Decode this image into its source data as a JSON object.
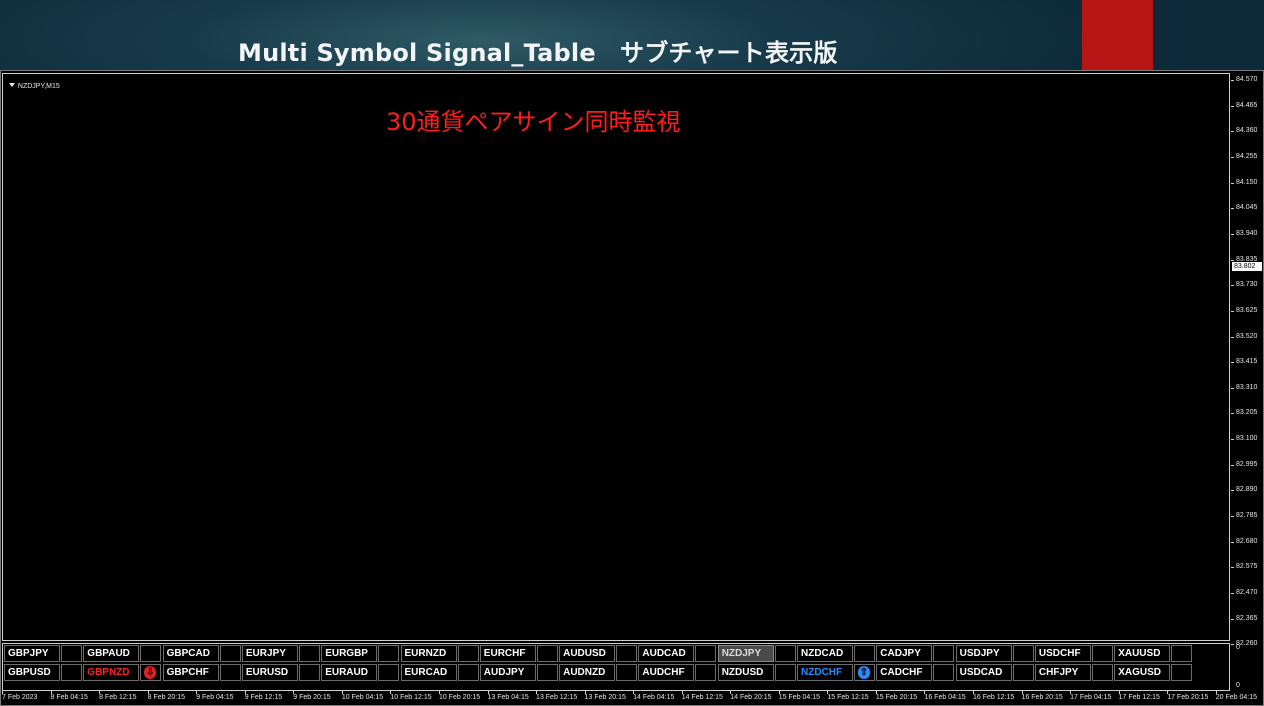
{
  "banner": {
    "title": "Multi Symbol Signal_Table　サブチャート表示版",
    "accent_color": "#b51614"
  },
  "chart": {
    "symbol_timeframe": "NZDJPY,M15",
    "overlay_text": "30通貨ペアサイン同時監視",
    "overlay_color": "#ff1c1c",
    "current_price": "83.802",
    "price_ticks": [
      "84.570",
      "84.465",
      "84.360",
      "84.255",
      "84.150",
      "84.045",
      "83.940",
      "83.835",
      "83.730",
      "83.625",
      "83.520",
      "83.415",
      "83.310",
      "83.205",
      "83.100",
      "82.995",
      "82.890",
      "82.785",
      "82.680",
      "82.575",
      "82.470",
      "82.365",
      "82.260"
    ],
    "time_ticks": [
      "7 Feb 2023",
      "8 Feb 04:15",
      "8 Feb 12:15",
      "8 Feb 20:15",
      "9 Feb 04:15",
      "9 Feb 12:15",
      "9 Feb 20:15",
      "10 Feb 04:15",
      "10 Feb 12:15",
      "10 Feb 20:15",
      "13 Feb 04:15",
      "13 Feb 12:15",
      "13 Feb 20:15",
      "14 Feb 04:15",
      "14 Feb 12:15",
      "14 Feb 20:15",
      "15 Feb 04:15",
      "15 Feb 12:15",
      "15 Feb 20:15",
      "16 Feb 04:15",
      "16 Feb 12:15",
      "16 Feb 20:15",
      "17 Feb 04:15",
      "17 Feb 12:15",
      "17 Feb 20:15",
      "20 Feb 04:15"
    ]
  },
  "subwindow": {
    "axis_top": "0",
    "axis_bottom": "0",
    "rows": [
      [
        {
          "symbol": "GBPJPY",
          "state": "normal",
          "signal": ""
        },
        {
          "symbol": "GBPAUD",
          "state": "normal",
          "signal": ""
        },
        {
          "symbol": "GBPCAD",
          "state": "normal",
          "signal": ""
        },
        {
          "symbol": "EURJPY",
          "state": "normal",
          "signal": ""
        },
        {
          "symbol": "EURGBP",
          "state": "normal",
          "signal": ""
        },
        {
          "symbol": "EURNZD",
          "state": "normal",
          "signal": ""
        },
        {
          "symbol": "EURCHF",
          "state": "normal",
          "signal": ""
        },
        {
          "symbol": "AUDUSD",
          "state": "normal",
          "signal": ""
        },
        {
          "symbol": "AUDCAD",
          "state": "normal",
          "signal": ""
        },
        {
          "symbol": "NZDJPY",
          "state": "selected",
          "signal": ""
        },
        {
          "symbol": "NZDCAD",
          "state": "normal",
          "signal": ""
        },
        {
          "symbol": "CADJPY",
          "state": "normal",
          "signal": ""
        },
        {
          "symbol": "USDJPY",
          "state": "normal",
          "signal": ""
        },
        {
          "symbol": "USDCHF",
          "state": "normal",
          "signal": ""
        },
        {
          "symbol": "XAUUSD",
          "state": "normal",
          "signal": ""
        }
      ],
      [
        {
          "symbol": "GBPUSD",
          "state": "normal",
          "signal": ""
        },
        {
          "symbol": "GBPNZD",
          "state": "sell",
          "signal": "down"
        },
        {
          "symbol": "GBPCHF",
          "state": "normal",
          "signal": ""
        },
        {
          "symbol": "EURUSD",
          "state": "normal",
          "signal": ""
        },
        {
          "symbol": "EURAUD",
          "state": "normal",
          "signal": ""
        },
        {
          "symbol": "EURCAD",
          "state": "normal",
          "signal": ""
        },
        {
          "symbol": "AUDJPY",
          "state": "normal",
          "signal": ""
        },
        {
          "symbol": "AUDNZD",
          "state": "normal",
          "signal": ""
        },
        {
          "symbol": "AUDCHF",
          "state": "normal",
          "signal": ""
        },
        {
          "symbol": "NZDUSD",
          "state": "normal",
          "signal": ""
        },
        {
          "symbol": "NZDCHF",
          "state": "buy",
          "signal": "up"
        },
        {
          "symbol": "CADCHF",
          "state": "normal",
          "signal": ""
        },
        {
          "symbol": "USDCAD",
          "state": "normal",
          "signal": ""
        },
        {
          "symbol": "CHFJPY",
          "state": "normal",
          "signal": ""
        },
        {
          "symbol": "XAGUSD",
          "state": "normal",
          "signal": ""
        }
      ]
    ],
    "signal_glyphs": {
      "down": "⇩",
      "up": "⇧"
    },
    "sell_color": "#ff2020",
    "buy_color": "#2b8cff"
  }
}
